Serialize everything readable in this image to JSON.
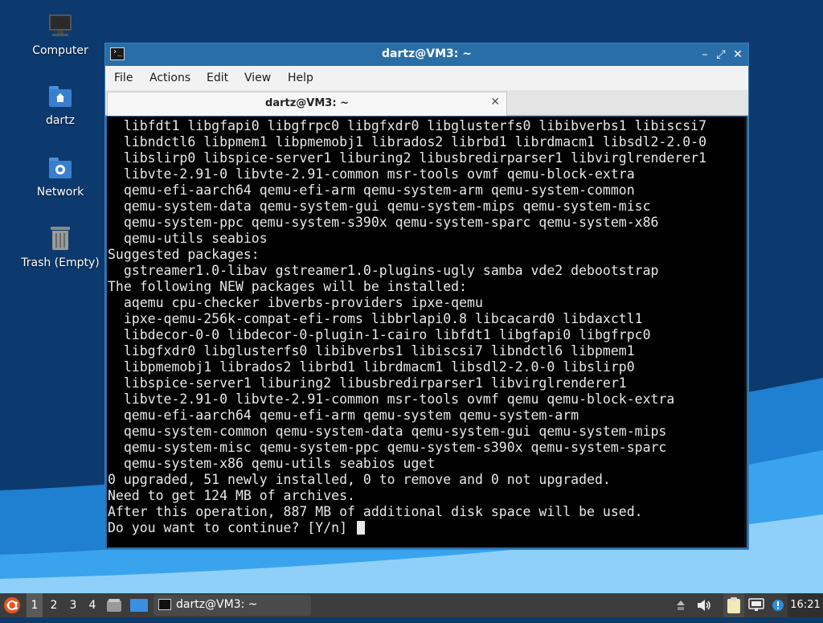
{
  "desktop": {
    "icons": [
      {
        "label": "Computer"
      },
      {
        "label": "dartz"
      },
      {
        "label": "Network"
      },
      {
        "label": "Trash (Empty)"
      }
    ]
  },
  "window": {
    "title": "dartz@VM3: ~",
    "menu": [
      "File",
      "Actions",
      "Edit",
      "View",
      "Help"
    ],
    "tab": {
      "title": "dartz@VM3: ~"
    }
  },
  "terminal": {
    "lines": [
      "  libfdt1 libgfapi0 libgfrpc0 libgfxdr0 libglusterfs0 libibverbs1 libiscsi7",
      "  libndctl6 libpmem1 libpmemobj1 librados2 librbd1 librdmacm1 libsdl2-2.0-0",
      "  libslirp0 libspice-server1 liburing2 libusbredirparser1 libvirglrenderer1",
      "  libvte-2.91-0 libvte-2.91-common msr-tools ovmf qemu-block-extra",
      "  qemu-efi-aarch64 qemu-efi-arm qemu-system-arm qemu-system-common",
      "  qemu-system-data qemu-system-gui qemu-system-mips qemu-system-misc",
      "  qemu-system-ppc qemu-system-s390x qemu-system-sparc qemu-system-x86",
      "  qemu-utils seabios",
      "Suggested packages:",
      "  gstreamer1.0-libav gstreamer1.0-plugins-ugly samba vde2 debootstrap",
      "The following NEW packages will be installed:",
      "  aqemu cpu-checker ibverbs-providers ipxe-qemu",
      "  ipxe-qemu-256k-compat-efi-roms libbrlapi0.8 libcacard0 libdaxctl1",
      "  libdecor-0-0 libdecor-0-plugin-1-cairo libfdt1 libgfapi0 libgfrpc0",
      "  libgfxdr0 libglusterfs0 libibverbs1 libiscsi7 libndctl6 libpmem1",
      "  libpmemobj1 librados2 librbd1 librdmacm1 libsdl2-2.0-0 libslirp0",
      "  libspice-server1 liburing2 libusbredirparser1 libvirglrenderer1",
      "  libvte-2.91-0 libvte-2.91-common msr-tools ovmf qemu qemu-block-extra",
      "  qemu-efi-aarch64 qemu-efi-arm qemu-system qemu-system-arm",
      "  qemu-system-common qemu-system-data qemu-system-gui qemu-system-mips",
      "  qemu-system-misc qemu-system-ppc qemu-system-s390x qemu-system-sparc",
      "  qemu-system-x86 qemu-utils seabios uget",
      "0 upgraded, 51 newly installed, 0 to remove and 0 not upgraded.",
      "Need to get 124 MB of archives.",
      "After this operation, 887 MB of additional disk space will be used."
    ],
    "prompt": "Do you want to continue? [Y/n] "
  },
  "taskbar": {
    "workspaces": [
      "1",
      "2",
      "3",
      "4"
    ],
    "task_label": "dartz@VM3: ~",
    "clock": "16:21"
  }
}
